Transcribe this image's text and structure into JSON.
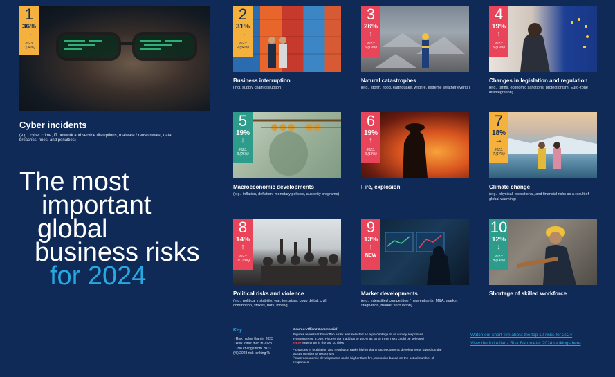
{
  "headline": {
    "line1": "The most",
    "line2": "important",
    "line3": "global",
    "line4": "business risks",
    "line5": "for 2024"
  },
  "risks": [
    {
      "rank": "1",
      "pct": "36%",
      "trend": "same",
      "arrow": "→",
      "prev_label": "2023:",
      "prev": "1 (34%)",
      "title": "Cyber incidents",
      "subtitle": "(e.g., cyber crime, IT network and service disruptions, malware / ransomware, data breaches, fines, and penalties)",
      "image": "cyber-face-image"
    },
    {
      "rank": "2",
      "pct": "31%",
      "trend": "same",
      "arrow": "→",
      "prev_label": "2023:",
      "prev": "2 (34%)",
      "title": "Business interruption",
      "subtitle": "(incl. supply chain disruption)",
      "image": "containers-image"
    },
    {
      "rank": "3",
      "pct": "26%",
      "trend": "up",
      "arrow": "↑",
      "prev_label": "2023:",
      "prev": "6 (19%)",
      "title": "Natural catastrophes",
      "subtitle": "(e.g., storm, flood, earthquake, wildfire, extreme weather events)",
      "image": "rubble-image"
    },
    {
      "rank": "4",
      "pct": "19%",
      "trend": "up",
      "arrow": "↑",
      "prev_label": "2023:",
      "prev": "5 (19%)",
      "title": "Changes in legislation and regulation",
      "subtitle": "(e.g., tariffs, economic sanctions, protectionism, Euro-zone disintegration)",
      "image": "eu-flag-image"
    },
    {
      "rank": "5",
      "pct": "19%",
      "trend": "down",
      "arrow": "↓",
      "prev_label": "2023:",
      "prev": "3 (25%)",
      "title": "Macroeconomic developments",
      "subtitle": "(e.g., inflation, deflation, monetary policies, austerity programs)",
      "image": "dollar-image"
    },
    {
      "rank": "6",
      "pct": "19%",
      "trend": "up",
      "arrow": "↑",
      "prev_label": "2023:",
      "prev": "9 (14%)",
      "title": "Fire, explosion",
      "subtitle": "",
      "image": "firefighter-image"
    },
    {
      "rank": "7",
      "pct": "18%",
      "trend": "same",
      "arrow": "→",
      "prev_label": "2023:",
      "prev": "7 (17%)",
      "title": "Climate change",
      "subtitle": "(e.g., physical, operational, and financial risks as a result of global warming)",
      "image": "glacier-image"
    },
    {
      "rank": "8",
      "pct": "14%",
      "trend": "up",
      "arrow": "↑",
      "prev_label": "2023:",
      "prev": "10 (13%)",
      "title": "Political risks and violence",
      "subtitle": "(e.g., political instability, war, terrorism, coup d'état, civil commotion, strikes, riots, looting)",
      "image": "protest-image"
    },
    {
      "rank": "9",
      "pct": "13%",
      "trend": "up",
      "arrow": "↑",
      "prev_label": "",
      "prev": "NEW",
      "title": "Market developments",
      "subtitle": "(e.g., intensified competition / new entrants, M&A, market stagnation, market fluctuation)",
      "image": "trader-image"
    },
    {
      "rank": "10",
      "pct": "12%",
      "trend": "down",
      "arrow": "↓",
      "prev_label": "2023:",
      "prev": "8 (14%)",
      "title": "Shortage of skilled workforce",
      "subtitle": "",
      "image": "welder-image"
    }
  ],
  "key": {
    "title": "Key",
    "items": [
      {
        "symbol": "↑",
        "text": "Risk higher than in 2023",
        "color": "#e8455a"
      },
      {
        "symbol": "↓",
        "text": "Risk lower than in 2023",
        "color": "#2e9c8a"
      },
      {
        "symbol": "→",
        "text": "No change from 2023",
        "color": "#f5b13d"
      },
      {
        "symbol": "",
        "text": "(%) 2023 risk ranking %",
        "color": "#dfe6f2"
      }
    ]
  },
  "source": {
    "title": "Source: Allianz Commercial",
    "line1": "Figures represent how often a risk was selected as a percentage of all survey responses",
    "line2": "Respondents: 3,069. Figures don't add up to 100% as up to three risks could be selected",
    "new_label": "NEW",
    "new_text": "New entry in the top 10 risks",
    "note1": "¹ changes in legislation and regulation ranks higher than macroeconomic developments based on the actual number of responses",
    "note2": "² macroeconomic developments ranks higher than fire, explosion based on the actual number of responses"
  },
  "links": {
    "film": "Watch our short film about the top 10 risks for 2024",
    "rankings": "View the full Allianz Risk Barometer 2024 rankings here"
  },
  "colors": {
    "background": "#0f2a57",
    "up": "#e8455a",
    "down": "#2e9c8a",
    "same": "#f5b13d",
    "accent": "#27a8e0"
  }
}
